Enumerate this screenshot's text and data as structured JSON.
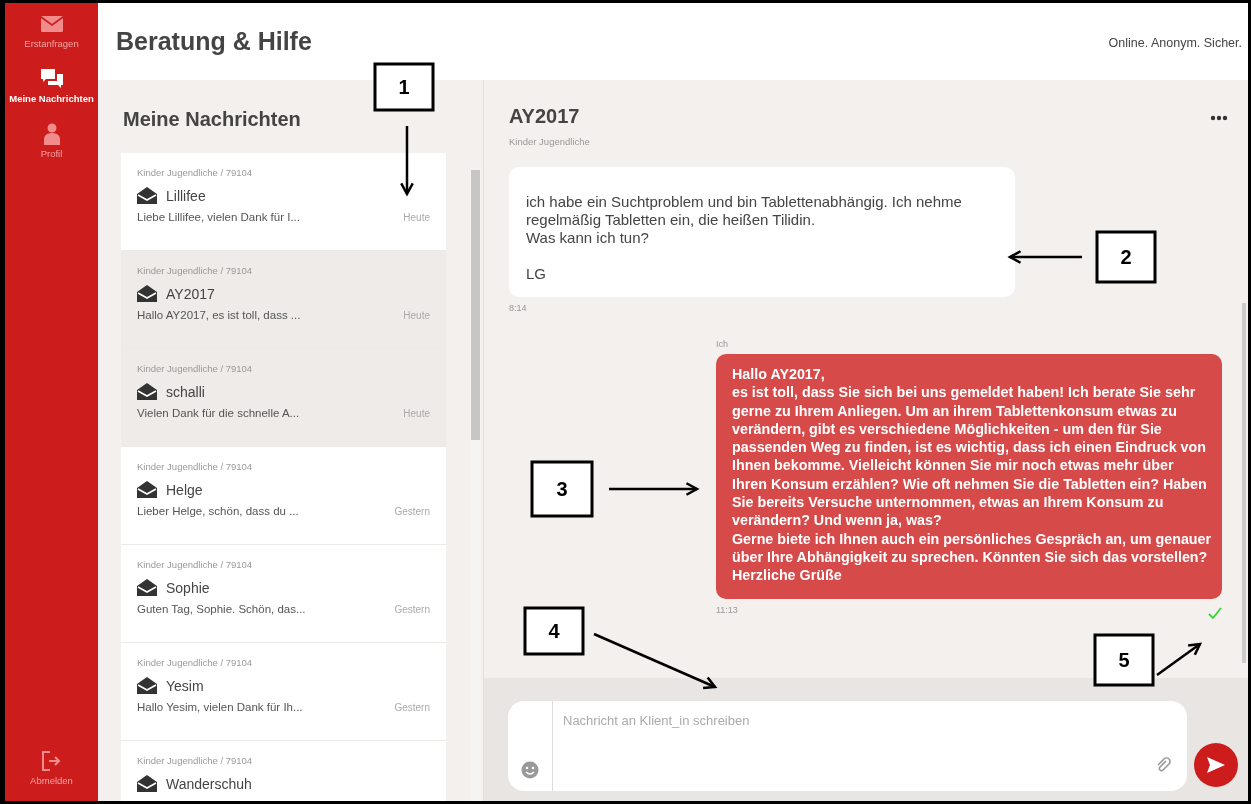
{
  "sidebar": {
    "items": [
      {
        "label": "Erstanfragen",
        "kind": "envelope",
        "selected": false
      },
      {
        "label": "Meine Nachrichten",
        "kind": "chats",
        "selected": true
      },
      {
        "label": "Profil",
        "kind": "person",
        "selected": false
      }
    ],
    "logout": "Abmelden"
  },
  "header": {
    "title": "Beratung & Hilfe",
    "tagline": "Online. Anonym. Sicher."
  },
  "inbox": {
    "title": "Meine Nachrichten",
    "conversations": [
      {
        "category": "Kinder Jugendliche / 79104",
        "name": "Lillifee",
        "preview": "Liebe Lillifee, vielen Dank für I...",
        "time": "Heute",
        "highlighted": false
      },
      {
        "category": "Kinder Jugendliche / 79104",
        "name": "AY2017",
        "preview": "Hallo AY2017, es ist toll, dass ...",
        "time": "Heute",
        "highlighted": true
      },
      {
        "category": "Kinder Jugendliche / 79104",
        "name": "schalli",
        "preview": "Vielen Dank für die schnelle A...",
        "time": "Heute",
        "highlighted": true
      },
      {
        "category": "Kinder Jugendliche / 79104",
        "name": "Helge",
        "preview": "Lieber Helge, schön, dass du ...",
        "time": "Gestern",
        "highlighted": false
      },
      {
        "category": "Kinder Jugendliche / 79104",
        "name": "Sophie",
        "preview": "Guten Tag, Sophie. Schön, das...",
        "time": "Gestern",
        "highlighted": false
      },
      {
        "category": "Kinder Jugendliche / 79104",
        "name": "Yesim",
        "preview": "Hallo Yesim, vielen Dank für Ih...",
        "time": "Gestern",
        "highlighted": false
      },
      {
        "category": "Kinder Jugendliche / 79104",
        "name": "Wanderschuh",
        "highlighted": false
      }
    ]
  },
  "chat": {
    "title": "AY2017",
    "subtitle": "Kinder Jugendliche",
    "messages": [
      {
        "kind": "incoming",
        "text": "ich habe ein Suchtproblem und bin Tablettenabhängig. Ich nehme regelmäßig Tabletten ein, die heißen Tilidin.\nWas kann ich tun?\n\nLG",
        "time": "8:14"
      },
      {
        "kind": "outgoing",
        "sender": "Ich",
        "text": "Hallo AY2017,\nes ist toll, dass Sie sich bei uns gemeldet haben! Ich berate Sie sehr gerne zu Ihrem Anliegen. Um an ihrem Tablettenkonsum etwas zu verändern, gibt es verschiedene Möglichkeiten - um den für Sie passenden Weg zu finden, ist es wichtig, dass ich einen Eindruck von Ihnen bekomme. Vielleicht können Sie mir noch etwas mehr über Ihren Konsum erzählen? Wie oft nehmen Sie die Tabletten ein? Haben Sie bereits Versuche unternommen, etwas an Ihrem Konsum zu verändern? Und wenn ja, was?\nGerne biete ich Ihnen auch ein persönliches Gespräch an, um genauer über Ihre Abhängigkeit zu sprechen. Könnten Sie sich das vorstellen?\nHerzliche Grüße",
        "time": "11:13",
        "delivered": true
      }
    ],
    "composer": {
      "placeholder": "Nachricht an Klient_in schreiben"
    }
  },
  "annotations": [
    {
      "label": "1"
    },
    {
      "label": "2"
    },
    {
      "label": "3"
    },
    {
      "label": "4"
    },
    {
      "label": "5"
    }
  ]
}
